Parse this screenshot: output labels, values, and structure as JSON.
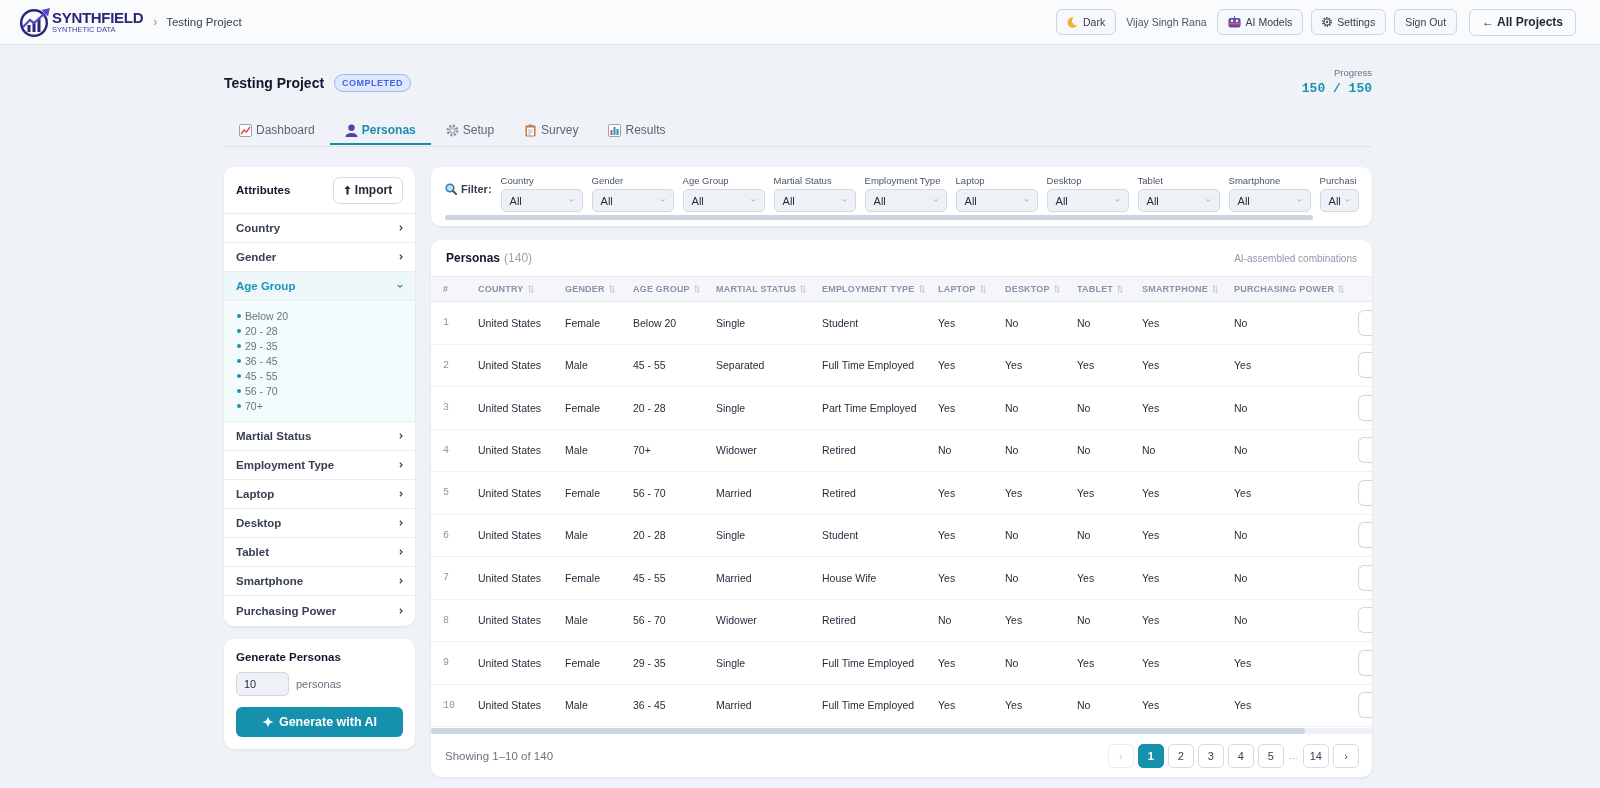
{
  "header": {
    "logo": {
      "name": "SYNTHFIELD",
      "tagline": "SYNTHETIC DATA"
    },
    "breadcrumb": {
      "separator": "›",
      "current": "Testing Project"
    },
    "actions": [
      {
        "kind": "theme",
        "label": "Dark"
      },
      {
        "kind": "user",
        "label": "Vijay Singh Rana"
      },
      {
        "kind": "models",
        "label": "AI Models"
      },
      {
        "kind": "settings",
        "label": "Settings"
      },
      {
        "kind": "signout",
        "label": "Sign Out"
      },
      {
        "kind": "back",
        "label": "← All Projects"
      }
    ]
  },
  "project": {
    "title": "Testing Project",
    "status": "COMPLETED",
    "progress_label": "Progress",
    "progress": "150 / 150"
  },
  "tabs": [
    {
      "kind": "dashboard",
      "label": "Dashboard",
      "selected": false
    },
    {
      "kind": "personas",
      "label": "Personas",
      "selected": true
    },
    {
      "kind": "setup",
      "label": "Setup",
      "selected": false
    },
    {
      "kind": "survey",
      "label": "Survey",
      "selected": false
    },
    {
      "kind": "results",
      "label": "Results",
      "selected": false
    }
  ],
  "sidebar": {
    "title": "Attributes",
    "import_button": "Import",
    "items": [
      {
        "label": "Country",
        "expanded": false
      },
      {
        "label": "Gender",
        "expanded": false
      },
      {
        "label": "Age Group",
        "expanded": true,
        "children": [
          {
            "label": "Below 20"
          },
          {
            "label": "20 - 28"
          },
          {
            "label": "29 - 35"
          },
          {
            "label": "36 - 45"
          },
          {
            "label": "45 - 55"
          },
          {
            "label": "56 - 70"
          },
          {
            "label": "70+"
          }
        ]
      },
      {
        "label": "Martial Status",
        "expanded": false
      },
      {
        "label": "Employment Type",
        "expanded": false
      },
      {
        "label": "Laptop",
        "expanded": false
      },
      {
        "label": "Desktop",
        "expanded": false
      },
      {
        "label": "Tablet",
        "expanded": false
      },
      {
        "label": "Smartphone",
        "expanded": false
      },
      {
        "label": "Purchasing Power",
        "expanded": false
      }
    ]
  },
  "generate": {
    "title": "Generate Personas",
    "count": "10",
    "unit": "personas",
    "button": "Generate with AI"
  },
  "filter": {
    "label": "Filter:",
    "fields": [
      {
        "label": "Country",
        "value": "All"
      },
      {
        "label": "Gender",
        "value": "All"
      },
      {
        "label": "Age Group",
        "value": "All"
      },
      {
        "label": "Martial Status",
        "value": "All"
      },
      {
        "label": "Employment Type",
        "value": "All"
      },
      {
        "label": "Laptop",
        "value": "All"
      },
      {
        "label": "Desktop",
        "value": "All"
      },
      {
        "label": "Tablet",
        "value": "All"
      },
      {
        "label": "Smartphone",
        "value": "All"
      },
      {
        "label": "Purchasi",
        "value": "All"
      }
    ]
  },
  "personas": {
    "title": "Personas",
    "count": "(140)",
    "note": "AI-assembled combinations",
    "columns": [
      {
        "label": "#",
        "sortable": false
      },
      {
        "label": "COUNTRY",
        "sortable": true
      },
      {
        "label": "GENDER",
        "sortable": true
      },
      {
        "label": "AGE GROUP",
        "sortable": true
      },
      {
        "label": "MARTIAL STATUS",
        "sortable": true
      },
      {
        "label": "EMPLOYMENT TYPE",
        "sortable": true
      },
      {
        "label": "LAPTOP",
        "sortable": true
      },
      {
        "label": "DESKTOP",
        "sortable": true
      },
      {
        "label": "TABLET",
        "sortable": true
      },
      {
        "label": "SMARTPHONE",
        "sortable": true
      },
      {
        "label": "PURCHASING POWER",
        "sortable": true
      }
    ],
    "rows": [
      [
        "1",
        "United States",
        "Female",
        "Below 20",
        "Single",
        "Student",
        "Yes",
        "No",
        "No",
        "Yes",
        "No"
      ],
      [
        "2",
        "United States",
        "Male",
        "45 - 55",
        "Separated",
        "Full Time Employed",
        "Yes",
        "Yes",
        "Yes",
        "Yes",
        "Yes"
      ],
      [
        "3",
        "United States",
        "Female",
        "20 - 28",
        "Single",
        "Part Time Employed",
        "Yes",
        "No",
        "No",
        "Yes",
        "No"
      ],
      [
        "4",
        "United States",
        "Male",
        "70+",
        "Widower",
        "Retired",
        "No",
        "No",
        "No",
        "No",
        "No"
      ],
      [
        "5",
        "United States",
        "Female",
        "56 - 70",
        "Married",
        "Retired",
        "Yes",
        "Yes",
        "Yes",
        "Yes",
        "Yes"
      ],
      [
        "6",
        "United States",
        "Male",
        "20 - 28",
        "Single",
        "Student",
        "Yes",
        "No",
        "No",
        "Yes",
        "No"
      ],
      [
        "7",
        "United States",
        "Female",
        "45 - 55",
        "Married",
        "House Wife",
        "Yes",
        "No",
        "Yes",
        "Yes",
        "No"
      ],
      [
        "8",
        "United States",
        "Male",
        "56 - 70",
        "Widower",
        "Retired",
        "No",
        "Yes",
        "No",
        "Yes",
        "No"
      ],
      [
        "9",
        "United States",
        "Female",
        "29 - 35",
        "Single",
        "Full Time Employed",
        "Yes",
        "No",
        "Yes",
        "Yes",
        "Yes"
      ],
      [
        "10",
        "United States",
        "Male",
        "36 - 45",
        "Married",
        "Full Time Employed",
        "Yes",
        "Yes",
        "No",
        "Yes",
        "Yes"
      ]
    ],
    "footer": "Showing 1–10 of 140",
    "pagination": [
      {
        "kind": "prev",
        "label": "‹",
        "selected": false,
        "disabled": true
      },
      {
        "kind": "page",
        "label": "1",
        "selected": true,
        "disabled": false
      },
      {
        "kind": "page",
        "label": "2",
        "selected": false,
        "disabled": false
      },
      {
        "kind": "page",
        "label": "3",
        "selected": false,
        "disabled": false
      },
      {
        "kind": "page",
        "label": "4",
        "selected": false,
        "disabled": false
      },
      {
        "kind": "page",
        "label": "5",
        "selected": false,
        "disabled": false
      },
      {
        "kind": "gap",
        "label": "…",
        "selected": false,
        "disabled": false
      },
      {
        "kind": "page",
        "label": "14",
        "selected": false,
        "disabled": false
      },
      {
        "kind": "next",
        "label": "›",
        "selected": false,
        "disabled": false
      }
    ]
  }
}
